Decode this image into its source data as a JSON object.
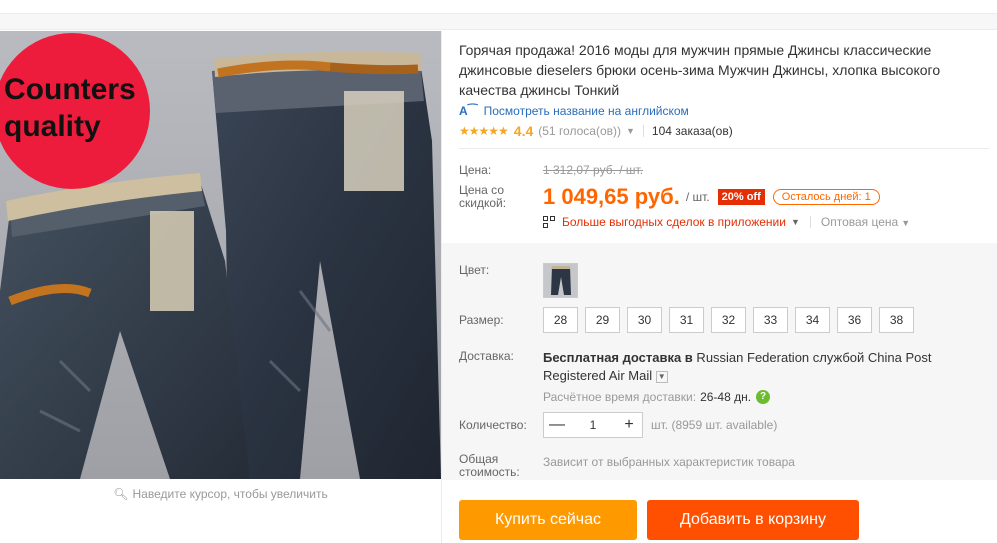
{
  "product": {
    "title": "Горячая продажа! 2016 моды для мужчин прямые Джинсы классические джинсовые dieselers брюки осень-зима Мужчин Джинсы, хлопка высокого качества джинсы Тонкий",
    "translate_link": "Посмотреть название на английском",
    "rating_stars": "★★★★★",
    "rating_value": "4.4",
    "rating_count": "(51 голоса(ов))",
    "orders": "104 заказа(ов)"
  },
  "image": {
    "badge_line1": "Counters",
    "badge_line2": "quality",
    "badge_color": "#ee1c3c",
    "zoom_hint": "Наведите курсор, чтобы увеличить"
  },
  "price": {
    "label_price": "Цена:",
    "old_price": "1 312,07 руб. / шт.",
    "label_discount": "Цена со скидкой:",
    "new_price": "1 049,65 руб.",
    "per_unit": "/ шт.",
    "discount_badge": "20% off",
    "days_left": "Осталось дней: 1",
    "accent_color": "#ff6600"
  },
  "app_deals": {
    "link": "Больше выгодных сделок в приложении",
    "wholesale": "Оптовая цена"
  },
  "options": {
    "color_label": "Цвет:",
    "size_label": "Размер:",
    "sizes": [
      "28",
      "29",
      "30",
      "31",
      "32",
      "33",
      "34",
      "36",
      "38"
    ]
  },
  "shipping": {
    "label": "Доставка:",
    "bold_part": "Бесплатная доставка в",
    "rest": " Russian Federation службой China Post Registered Air Mail",
    "time_label": "Расчётное время доставки:",
    "time_value": "26-48 дн.",
    "help_icon": "?"
  },
  "quantity": {
    "label": "Количество:",
    "minus": "—",
    "value": "1",
    "plus": "+",
    "available": "шт. (8959 шт. available)"
  },
  "total": {
    "label": "Общая стоимость:",
    "value": "Зависит от выбранных характеристик товара"
  },
  "actions": {
    "buy_now": "Купить сейчас",
    "add_to_cart": "Добавить в корзину",
    "buy_color": "#ff9900",
    "cart_color": "#ff4f00"
  }
}
